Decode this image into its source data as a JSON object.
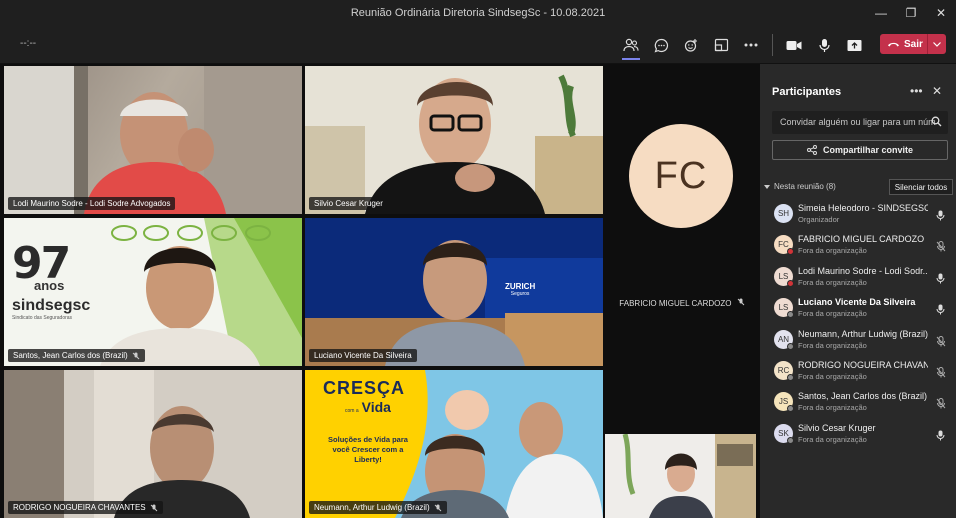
{
  "window": {
    "title": "Reunião Ordinária Diretoria SindsegSc - 10.08.2021"
  },
  "toolbar": {
    "timer": "--:--",
    "leave_label": "Sair"
  },
  "participants_tiles": [
    {
      "name": "Lodi Maurino Sodre - Lodi Sodre Advogados",
      "muted": false
    },
    {
      "name": "Silvio Cesar Kruger",
      "muted": false
    },
    {
      "name": "Santos, Jean Carlos dos (Brazil)",
      "muted": true
    },
    {
      "name": "Luciano Vicente Da Silveira",
      "muted": false
    },
    {
      "name": "RODRIGO NOGUEIRA CHAVANTES",
      "muted": true
    },
    {
      "name": "Neumann, Arthur Ludwig (Brazil)",
      "muted": true
    }
  ],
  "side_tile": {
    "initials": "FC",
    "name": "FABRICIO MIGUEL CARDOZO"
  },
  "tile_content": {
    "anniversary_number": "97",
    "anniversary_word": "anos",
    "sindseg_logo": "sindsegsc",
    "sindseg_tagline": "Sindicato das Seguradoras",
    "zurich_logo": "ZURICH",
    "zurich_sub": "Seguros",
    "promo_title_1": "CRESÇA",
    "promo_com": "com a",
    "promo_title_2": "Vida",
    "promo_body": "Soluções de Vida para você Crescer com a Liberty!"
  },
  "panel": {
    "title": "Participantes",
    "search_placeholder": "Convidar alguém ou ligar para um núm",
    "share_label": "Compartilhar convite",
    "section_label": "Nesta reunião (8)",
    "mute_all_label": "Silenciar todos",
    "people": [
      {
        "initials": "SH",
        "name": "Simeia Heleodoro - SINDSEGSC",
        "role": "Organizador",
        "avatar_color": "#dbe2f3",
        "mic": "on",
        "bold": false,
        "dot": "none"
      },
      {
        "initials": "FC",
        "name": "FABRICIO MIGUEL CARDOZO",
        "role": "Fora da organização",
        "avatar_color": "#f6dcc2",
        "mic": "off",
        "bold": false,
        "dot": "red"
      },
      {
        "initials": "LS",
        "name": "Lodi Maurino Sodre - Lodi Sodr...",
        "role": "Fora da organização",
        "avatar_color": "#efdcd2",
        "mic": "on",
        "bold": false,
        "dot": "red"
      },
      {
        "initials": "LS",
        "name": "Luciano Vicente Da Silveira",
        "role": "Fora da organização",
        "avatar_color": "#efdcd2",
        "mic": "on",
        "bold": true,
        "dot": "grey"
      },
      {
        "initials": "AN",
        "name": "Neumann, Arthur Ludwig (Brazil)",
        "role": "Fora da organização",
        "avatar_color": "#e2e2ee",
        "mic": "off",
        "bold": false,
        "dot": "grey"
      },
      {
        "initials": "RC",
        "name": "RODRIGO NOGUEIRA CHAVANT...",
        "role": "Fora da organização",
        "avatar_color": "#f3e3c8",
        "mic": "off",
        "bold": false,
        "dot": "grey"
      },
      {
        "initials": "JS",
        "name": "Santos, Jean Carlos dos (Brazil)",
        "role": "Fora da organização",
        "avatar_color": "#f5e4bb",
        "mic": "off",
        "bold": false,
        "dot": "grey"
      },
      {
        "initials": "SK",
        "name": "Silvio Cesar Kruger",
        "role": "Fora da organização",
        "avatar_color": "#dcdcef",
        "mic": "on",
        "bold": false,
        "dot": "grey"
      }
    ]
  },
  "colors": {
    "accent": "#7b83eb",
    "leave": "#c4314b",
    "panel_bg": "#292929"
  }
}
